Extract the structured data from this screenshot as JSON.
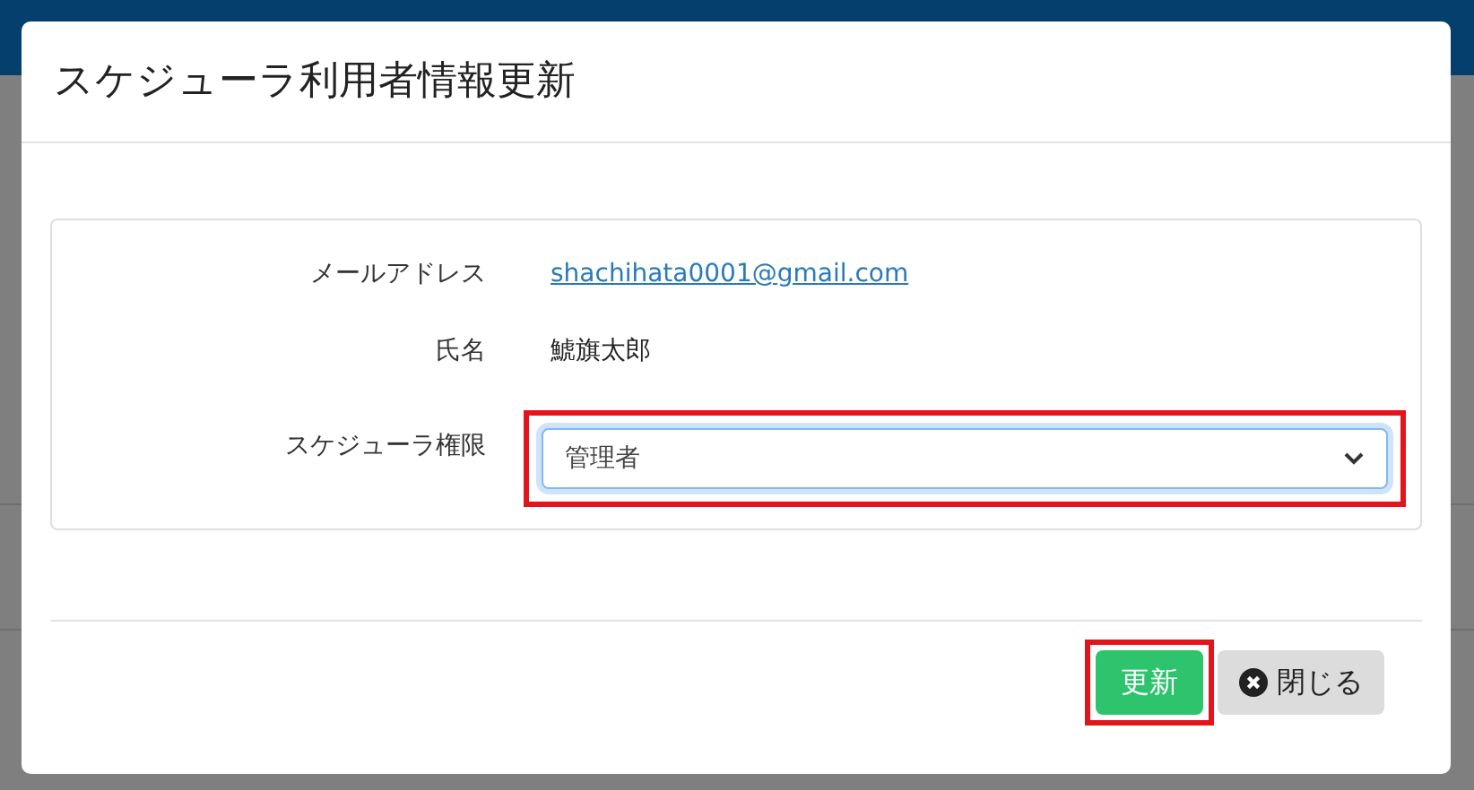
{
  "dialog": {
    "title": "スケジューラ利用者情報更新",
    "fields": [
      {
        "kind": "link",
        "label": "メールアドレス",
        "value": "shachihata0001@gmail.com"
      },
      {
        "kind": "text",
        "label": "氏名",
        "value": "鯱旗太郎"
      },
      {
        "kind": "select",
        "label": "スケジューラ権限",
        "value": "管理者",
        "highlighted": true
      }
    ],
    "buttons": [
      {
        "kind": "primary",
        "label": "更新",
        "highlighted": true
      },
      {
        "kind": "close",
        "label": "閉じる",
        "highlighted": false
      }
    ]
  }
}
